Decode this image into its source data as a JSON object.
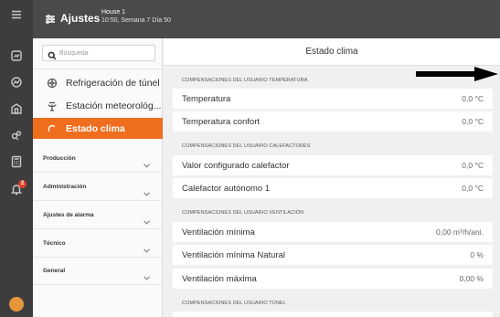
{
  "rail": {
    "icons": [
      "menu-icon",
      "dashboard-icon",
      "graph-icon",
      "barn-icon",
      "animals-icon",
      "calculator-icon",
      "alarm-bell-icon"
    ],
    "alarm_count": "2"
  },
  "header": {
    "title": "Ajustes",
    "house": "House 1",
    "when": "10:50, Semana 7 Día 50"
  },
  "sidebar": {
    "search_placeholder": "Búsqueda",
    "items": [
      {
        "label": "Refrigeración de túnel",
        "icon": "fan-icon",
        "active": false
      },
      {
        "label": "Estación meteorológ...",
        "icon": "weather-station-icon",
        "active": false
      },
      {
        "label": "Estado clima",
        "icon": "sun-icon",
        "active": true
      }
    ],
    "groups": [
      {
        "label": "Producción"
      },
      {
        "label": "Administración"
      },
      {
        "label": "Ajustes de alarma"
      },
      {
        "label": "Técnico"
      },
      {
        "label": "General"
      }
    ]
  },
  "main": {
    "title": "Estado clima",
    "sections": [
      {
        "header": "COMPENSACIONES DEL USUARIO TEMPERATURA",
        "rows": [
          {
            "label": "Temperatura",
            "value": "0,0 °C"
          },
          {
            "label": "Temperatura confort",
            "value": "0,0 °C"
          }
        ]
      },
      {
        "header": "COMPENSACIONES DEL USUARIO CALEFACTORES",
        "rows": [
          {
            "label": "Valor configurado calefactor",
            "value": "0,0 °C"
          },
          {
            "label": "Calefactor autónomo 1",
            "value": "0,0 °C"
          }
        ]
      },
      {
        "header": "COMPENSACIONES DEL USUARIO VENTILACIÓN",
        "rows": [
          {
            "label": "Ventilación mínima",
            "value": "0,00 m³/h/ani."
          },
          {
            "label": "Ventilación mínima Natural",
            "value": "0 %"
          },
          {
            "label": "Ventilación máxima",
            "value": "0,00 %"
          }
        ]
      },
      {
        "header": "COMPENSACIONES DEL USUARIO TÚNEL",
        "rows": []
      }
    ]
  },
  "colors": {
    "accent": "#ee6e1e",
    "rail": "#3d3d3d",
    "header": "#4a4a4a",
    "badge": "#e0412a"
  }
}
